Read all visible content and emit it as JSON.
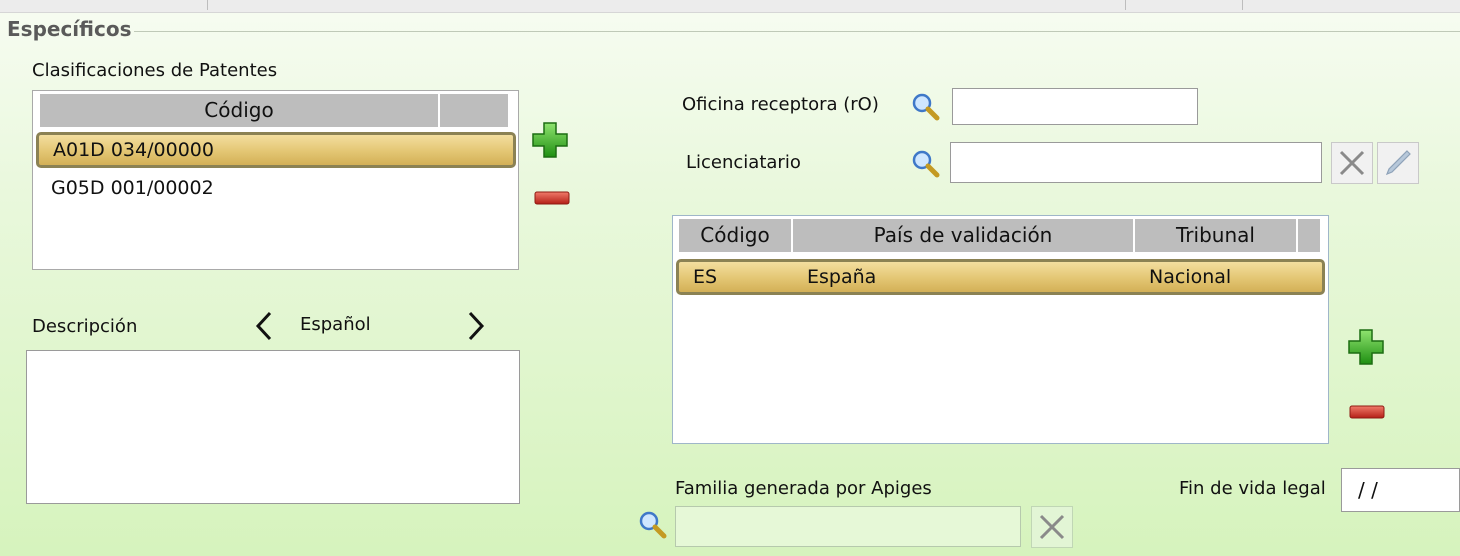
{
  "section": {
    "title": "Específicos"
  },
  "clasificaciones": {
    "label": "Clasificaciones de Patentes",
    "columns": [
      "Código"
    ],
    "rows": [
      {
        "code": "A01D 034/00000",
        "selected": true
      },
      {
        "code": "G05D 001/00002",
        "selected": false
      }
    ]
  },
  "descripcion": {
    "label": "Descripción",
    "language": "Español",
    "value": ""
  },
  "oficina": {
    "label": "Oficina receptora (rO)",
    "value": ""
  },
  "licenciatario": {
    "label": "Licenciatario",
    "value": ""
  },
  "validacion": {
    "columns": [
      "Código",
      "País de validación",
      "Tribunal"
    ],
    "rows": [
      {
        "code": "ES",
        "pais": "España",
        "tribunal": "Nacional",
        "selected": true
      }
    ]
  },
  "familia": {
    "label": "Familia generada por Apiges",
    "value": ""
  },
  "fin_vida": {
    "label": "Fin de vida legal",
    "value": " /  /"
  },
  "icons": {
    "add": "plus-icon",
    "remove": "minus-icon",
    "search": "magnifier-icon",
    "clear": "x-icon",
    "edit": "pencil-icon"
  },
  "colors": {
    "selection": "#e3c673",
    "selection_border": "#8b8254",
    "header_gray": "#bdbdbd",
    "add_green": "#3ab526",
    "remove_red": "#d63a2f",
    "background_green": "#d6f3bd"
  }
}
